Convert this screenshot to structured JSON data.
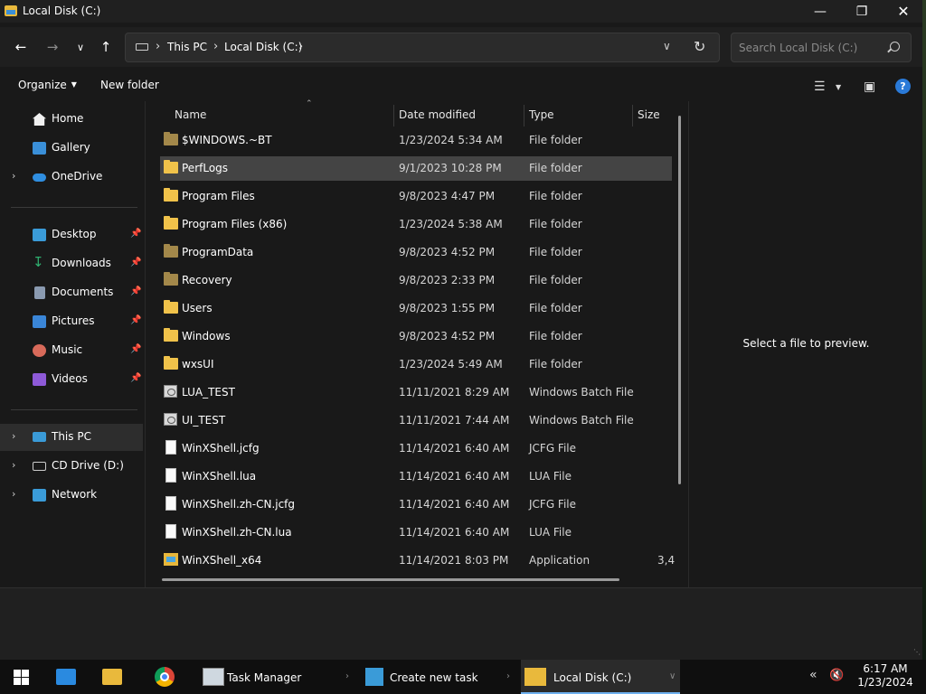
{
  "window": {
    "title": "Local Disk (C:)"
  },
  "address": {
    "crumbs": [
      "This PC",
      "Local Disk (C:)"
    ]
  },
  "search": {
    "placeholder": "Search Local Disk (C:)"
  },
  "commandbar": {
    "organize": "Organize",
    "new_folder": "New folder"
  },
  "sidebar": {
    "items": [
      {
        "label": "Home",
        "icon": "home-icon",
        "color": "#f5f5f5"
      },
      {
        "label": "Gallery",
        "icon": "gallery-icon",
        "color": "#3a8fd8"
      },
      {
        "label": "OneDrive",
        "icon": "onedrive-icon",
        "color": "#2f8ee0"
      },
      {
        "label": "Desktop",
        "icon": "desktop-icon",
        "color": "#3a9bd8"
      },
      {
        "label": "Downloads",
        "icon": "downloads-icon",
        "color": "#2fb070"
      },
      {
        "label": "Documents",
        "icon": "documents-icon",
        "color": "#8a9ab0"
      },
      {
        "label": "Pictures",
        "icon": "pictures-icon",
        "color": "#3a86d8"
      },
      {
        "label": "Music",
        "icon": "music-icon",
        "color": "#d86a5a"
      },
      {
        "label": "Videos",
        "icon": "videos-icon",
        "color": "#8e5ad8"
      },
      {
        "label": "This PC",
        "icon": "this-pc-icon",
        "color": "#3a9bd8"
      },
      {
        "label": "CD Drive (D:)",
        "icon": "cd-drive-icon",
        "color": "#cccccc"
      },
      {
        "label": "Network",
        "icon": "network-icon",
        "color": "#3a9bd8"
      }
    ]
  },
  "columns": {
    "name": "Name",
    "date": "Date modified",
    "type": "Type",
    "size": "Size"
  },
  "files": [
    {
      "name": "$WINDOWS.~BT",
      "date": "1/23/2024 5:34 AM",
      "type": "File folder",
      "size": "",
      "icon": "folder-dim"
    },
    {
      "name": "PerfLogs",
      "date": "9/1/2023 10:28 PM",
      "type": "File folder",
      "size": "",
      "icon": "folder"
    },
    {
      "name": "Program Files",
      "date": "9/8/2023 4:47 PM",
      "type": "File folder",
      "size": "",
      "icon": "folder"
    },
    {
      "name": "Program Files (x86)",
      "date": "1/23/2024 5:38 AM",
      "type": "File folder",
      "size": "",
      "icon": "folder"
    },
    {
      "name": "ProgramData",
      "date": "9/8/2023 4:52 PM",
      "type": "File folder",
      "size": "",
      "icon": "folder-dim"
    },
    {
      "name": "Recovery",
      "date": "9/8/2023 2:33 PM",
      "type": "File folder",
      "size": "",
      "icon": "folder-dim"
    },
    {
      "name": "Users",
      "date": "9/8/2023 1:55 PM",
      "type": "File folder",
      "size": "",
      "icon": "folder"
    },
    {
      "name": "Windows",
      "date": "9/8/2023 4:52 PM",
      "type": "File folder",
      "size": "",
      "icon": "folder"
    },
    {
      "name": "wxsUI",
      "date": "1/23/2024 5:49 AM",
      "type": "File folder",
      "size": "",
      "icon": "folder"
    },
    {
      "name": "LUA_TEST",
      "date": "11/11/2021 8:29 AM",
      "type": "Windows Batch File",
      "size": "",
      "icon": "bat"
    },
    {
      "name": "UI_TEST",
      "date": "11/11/2021 7:44 AM",
      "type": "Windows Batch File",
      "size": "",
      "icon": "bat"
    },
    {
      "name": "WinXShell.jcfg",
      "date": "11/14/2021 6:40 AM",
      "type": "JCFG File",
      "size": "",
      "icon": "file"
    },
    {
      "name": "WinXShell.lua",
      "date": "11/14/2021 6:40 AM",
      "type": "LUA File",
      "size": "",
      "icon": "file"
    },
    {
      "name": "WinXShell.zh-CN.jcfg",
      "date": "11/14/2021 6:40 AM",
      "type": "JCFG File",
      "size": "",
      "icon": "file"
    },
    {
      "name": "WinXShell.zh-CN.lua",
      "date": "11/14/2021 6:40 AM",
      "type": "LUA File",
      "size": "",
      "icon": "file"
    },
    {
      "name": "WinXShell_x64",
      "date": "11/14/2021 8:03 PM",
      "type": "Application",
      "size": "3,4",
      "icon": "app"
    }
  ],
  "preview": {
    "text": "Select a file to preview."
  },
  "taskbar": {
    "tasks": [
      {
        "label": "Task Manager"
      },
      {
        "label": "Create new task"
      },
      {
        "label": "Local Disk (C:)"
      }
    ],
    "clock_time": "6:17 AM",
    "clock_date": "1/23/2024"
  },
  "colors": {
    "folder": "#f0c24a",
    "folder_dim": "#a3884a",
    "accent": "#2a7ad8",
    "selected_row": "#444444"
  }
}
